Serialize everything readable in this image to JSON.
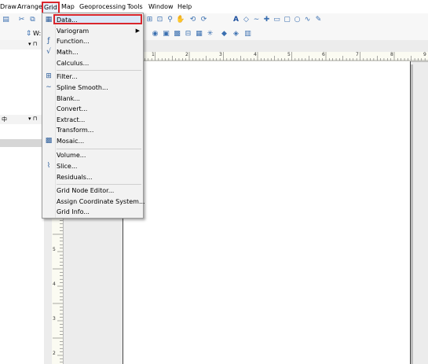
{
  "menubar": {
    "items": [
      {
        "label": "Draw"
      },
      {
        "label": "Arrange"
      },
      {
        "label": "Grid"
      },
      {
        "label": "Map"
      },
      {
        "label": "Geoprocessing"
      },
      {
        "label": "Tools"
      },
      {
        "label": "Window"
      },
      {
        "label": "Help"
      }
    ],
    "active_color": "#d9262c"
  },
  "toolbar": {
    "width_label": "W:"
  },
  "panels": {
    "top_close": "▾ ⊓",
    "second_title": "中",
    "second_close": "▾ ⊓"
  },
  "grid_menu": {
    "items": [
      {
        "label": "Data...",
        "icon": "grid-data-icon",
        "highlighted": true
      },
      {
        "label": "Variogram",
        "submenu": true
      },
      {
        "label": "Function...",
        "icon": "function-icon"
      },
      {
        "label": "Math...",
        "icon": "math-icon"
      },
      {
        "label": "Calculus..."
      },
      {
        "label": "Filter...",
        "icon": "filter-icon"
      },
      {
        "label": "Spline Smooth...",
        "icon": "spline-icon"
      },
      {
        "label": "Blank..."
      },
      {
        "label": "Convert..."
      },
      {
        "label": "Extract..."
      },
      {
        "label": "Transform..."
      },
      {
        "label": "Mosaic...",
        "icon": "mosaic-icon"
      },
      {
        "label": "Volume..."
      },
      {
        "label": "Slice...",
        "icon": "slice-icon"
      },
      {
        "label": "Residuals..."
      },
      {
        "label": "Grid Node Editor..."
      },
      {
        "label": "Assign Coordinate System..."
      },
      {
        "label": "Grid Info..."
      }
    ],
    "submenu_arrow": "▶"
  },
  "ruler": {
    "h_numbers": [
      "1",
      "2",
      "3",
      "4",
      "5",
      "6",
      "7",
      "8",
      "9"
    ],
    "v_numbers": [
      "5",
      "4",
      "3",
      "2"
    ]
  }
}
